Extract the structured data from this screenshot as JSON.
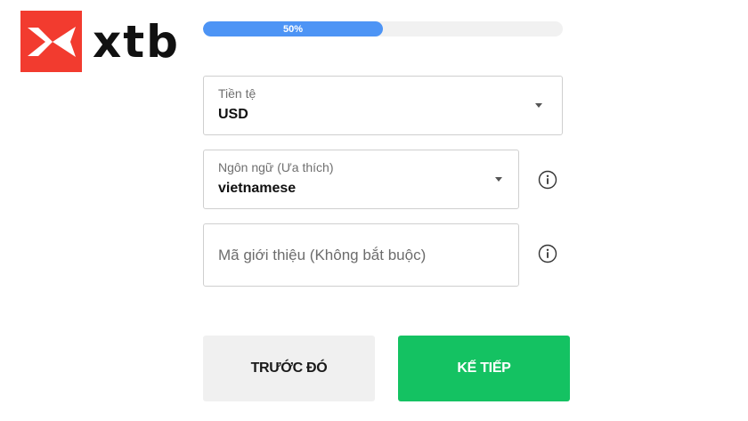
{
  "brand": {
    "logo_text": "xtb",
    "logo_icon": "x-mark-icon",
    "logo_color": "#f23b2f"
  },
  "progress": {
    "label": "50%",
    "value": 0.5,
    "fill_color": "#4d94f5"
  },
  "form": {
    "currency": {
      "label": "Tiền tệ",
      "value": "USD"
    },
    "language": {
      "label": "Ngôn ngữ (Ưa thích)",
      "value": "vietnamese"
    },
    "referral": {
      "placeholder": "Mã giới thiệu (Không bắt buộc)",
      "value": ""
    },
    "info_icon": "info-circle-icon"
  },
  "buttons": {
    "previous_label": "TRƯỚC ĐÓ",
    "next_label": "KẾ TIẾP",
    "next_color": "#14c262"
  }
}
